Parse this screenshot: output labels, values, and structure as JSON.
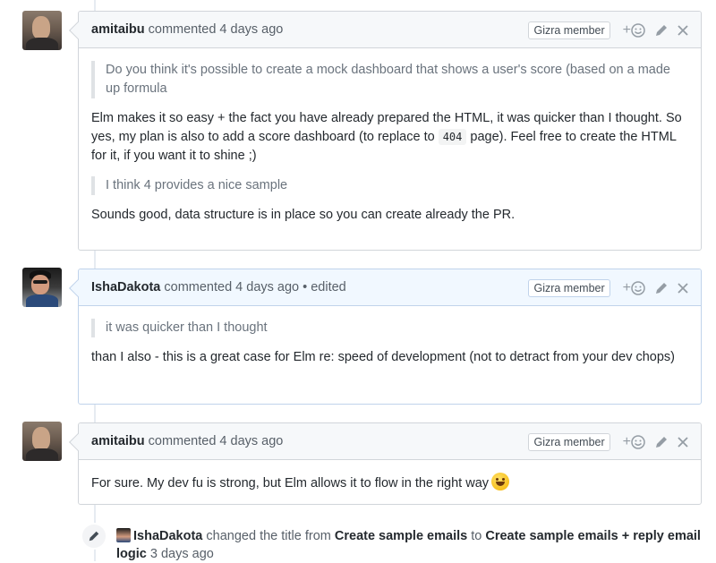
{
  "comments": [
    {
      "author": "amitaibu",
      "meta": "commented 4 days ago",
      "badge": "Gizra member",
      "quote1": "Do you think it's possible to create a mock dashboard that shows a user's score (based on a made up formula",
      "para1": "Elm makes it so easy + the fact you have already prepared the HTML, it was quicker than I thought. So yes, my plan is also to add a score dashboard (to replace to",
      "para1_code": "404",
      "para1_after": "page). Feel free to create the HTML for it, if you want it to shine ;)",
      "quote2": "I think 4 provides a nice sample",
      "para2": "Sounds good, data structure is in place so you can create already the PR."
    },
    {
      "author": "IshaDakota",
      "meta": "commented 4 days ago • edited",
      "badge": "Gizra member",
      "quote1": "it was quicker than I thought",
      "para1": "than I also - this is a great case for Elm re: speed of development (not to detract from your dev chops)"
    },
    {
      "author": "amitaibu",
      "meta": "commented 4 days ago",
      "badge": "Gizra member",
      "para1": "For sure. My dev fu is strong, but Elm allows it to flow in the right way"
    }
  ],
  "event": {
    "actor": "IshaDakota",
    "action": "changed the title from",
    "from_title": "Create sample emails",
    "to_word": "to",
    "to_title": "Create sample emails + reply email logic",
    "time": "3 days ago"
  },
  "reaction_plus": "+",
  "icons": [
    "smiley-icon",
    "pencil-icon",
    "close-icon"
  ]
}
